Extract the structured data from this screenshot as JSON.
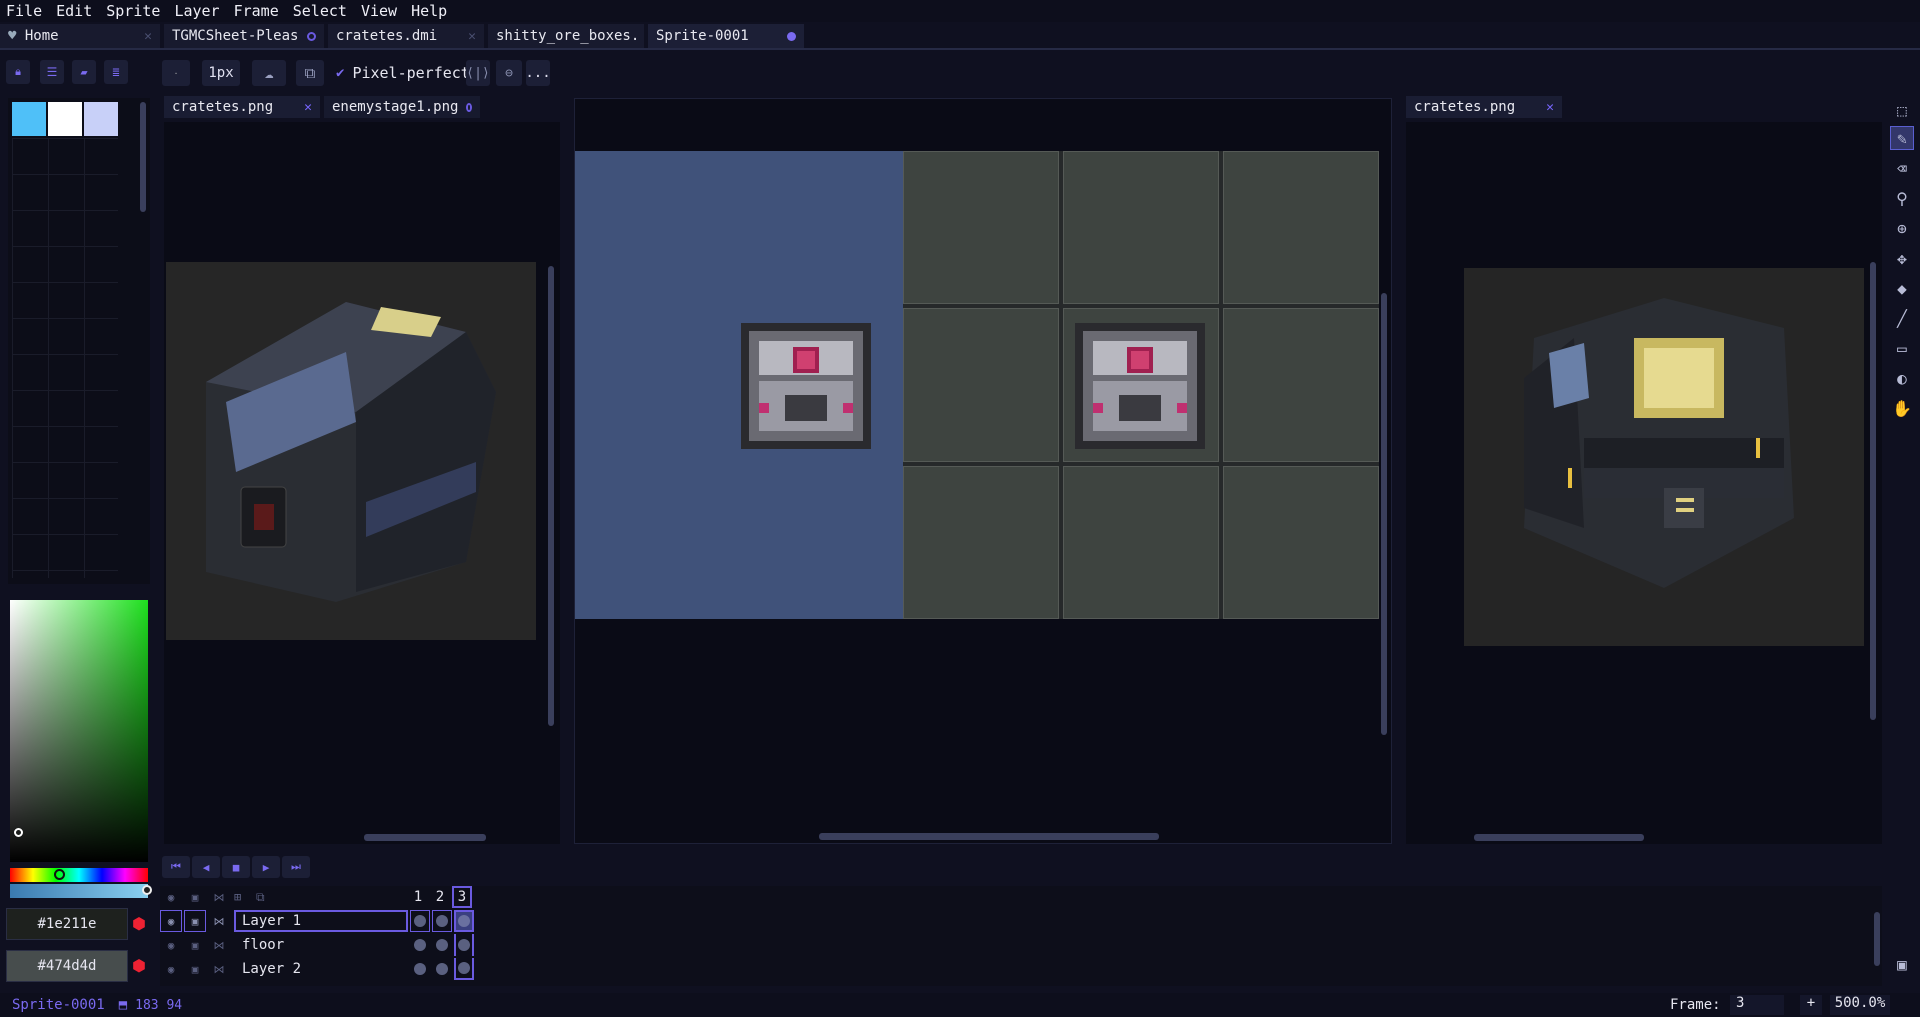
{
  "menu": [
    "File",
    "Edit",
    "Sprite",
    "Layer",
    "Frame",
    "Select",
    "View",
    "Help"
  ],
  "doc_tabs": [
    {
      "label": "Home",
      "state": "close"
    },
    {
      "label": "TGMCSheet-Pleas",
      "state": "modified"
    },
    {
      "label": "cratetes.dmi",
      "state": "close"
    },
    {
      "label": "shitty_ore_boxes.",
      "state": "close"
    },
    {
      "label": "Sprite-0001",
      "state": "active-modified"
    }
  ],
  "toolbar": {
    "brush_size": "1px",
    "pixel_perfect_label": "Pixel-perfect",
    "more_label": "..."
  },
  "left_pane": {
    "tabs": [
      {
        "label": "cratetes.png",
        "state": "close"
      },
      {
        "label": "enemystage1.png",
        "state": "modified"
      }
    ]
  },
  "right_pane": {
    "tabs": [
      {
        "label": "cratetes.png",
        "state": "close"
      }
    ]
  },
  "palette": {
    "colors": [
      "#4fc0f8",
      "#ffffff",
      "#c8d0f8"
    ]
  },
  "colors": {
    "fg_hex": "#1e211e",
    "bg_hex": "#474d4d",
    "accent": "#7a6af0",
    "canvas_bg": "#40527a",
    "floor_tile": "#3e4440"
  },
  "timeline": {
    "frames": [
      "1",
      "2",
      "3"
    ],
    "active_frame": "3",
    "layers": [
      {
        "name": "Layer 1",
        "active": true
      },
      {
        "name": "floor",
        "active": false
      },
      {
        "name": "Layer 2",
        "active": false
      }
    ]
  },
  "status": {
    "sprite_name": "Sprite-0001",
    "coords": "183 94",
    "frame_label": "Frame:",
    "frame_value": "3",
    "plus": "+",
    "zoom": "500.0%"
  }
}
